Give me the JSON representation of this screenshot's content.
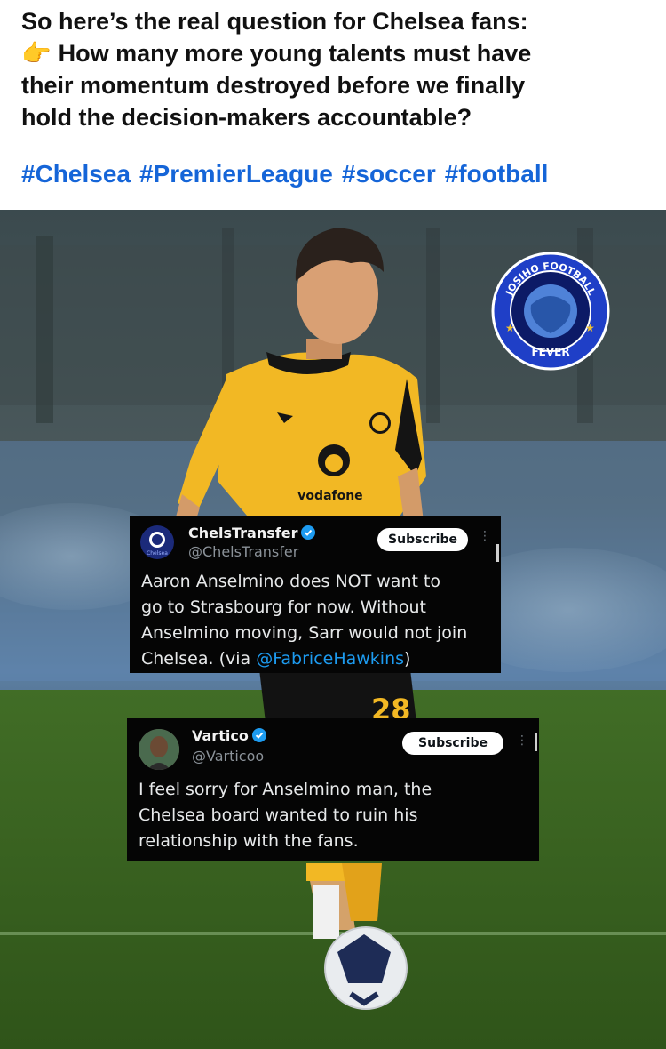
{
  "caption": {
    "line1": "So here’s the real question for Chelsea fans:",
    "hand_emoji": "👉",
    "line2": "How many more young talents must have",
    "line3": "their momentum destroyed before we finally",
    "line4": "hold the decision-makers accountable?",
    "hashtags": [
      "#Chelsea",
      "#PremierLeague",
      "#soccer",
      "#football"
    ]
  },
  "image": {
    "shirt_sponsor": "vodafone",
    "shirt_number": "28",
    "badge": {
      "top_text": "JOSIHO FOOTBALL",
      "bottom_text": "FEVER"
    },
    "icon_names": [
      "vodafone-logo",
      "bvb-crest",
      "puma-logo",
      "football"
    ]
  },
  "tweets": [
    {
      "display_name": "ChelsTransfer",
      "handle": "@ChelsTransfer",
      "avatar_text": "Chelsea",
      "subscribe_label": "Subscribe",
      "body_before_mention": "Aaron Anselmino does NOT want to go to Strasbourg for now.  Without Anselmino moving, Sarr would not join Chelsea. (via ",
      "mention": "@FabriceHawkins",
      "body_after_mention": ")",
      "lines": [
        "Aaron Anselmino does NOT want to",
        "go to Strasbourg for now.  Without",
        "Anselmino moving, Sarr would not join"
      ],
      "last_line_prefix": "Chelsea. (via "
    },
    {
      "display_name": "Vartico",
      "handle": "@Varticoo",
      "subscribe_label": "Subscribe",
      "lines": [
        "I feel sorry for Anselmino man, the",
        "Chelsea board wanted to ruin his",
        "relationship with the fans."
      ]
    }
  ],
  "colors": {
    "hashtag": "#1565d8",
    "mention": "#1d9bf0",
    "verified": "#1d9bf0",
    "jersey": "#f2b824",
    "pitch": "#3e6a24"
  }
}
